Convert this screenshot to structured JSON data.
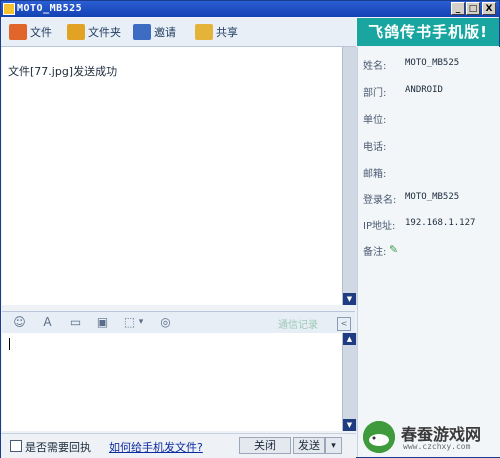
{
  "window": {
    "title": "MOTO_MB525"
  },
  "window_buttons": [
    {
      "icon": "minimize-icon",
      "glyph": "_"
    },
    {
      "icon": "maximize-icon",
      "glyph": "□"
    },
    {
      "icon": "close-icon",
      "glyph": "X"
    }
  ],
  "toolbar": {
    "items": [
      {
        "label": "文件",
        "icon": "file-send-icon",
        "color": "#e0662b"
      },
      {
        "label": "文件夹",
        "icon": "folder-send-icon",
        "color": "#e2a324"
      },
      {
        "label": "邀请",
        "icon": "invite-icon",
        "color": "#3d6cc2"
      },
      {
        "label": "共享",
        "icon": "share-folder-icon",
        "color": "#e5b33a"
      }
    ]
  },
  "banner": {
    "text": "飞鸽传书手机版!"
  },
  "messages": [
    {
      "text": "文件[77.jpg]发送成功"
    }
  ],
  "format_toolbar": {
    "icons": [
      {
        "name": "emoji-icon",
        "glyph": "☺"
      },
      {
        "name": "font-icon",
        "glyph": "A"
      },
      {
        "name": "message-bubble-icon",
        "glyph": "▭"
      },
      {
        "name": "image-icon",
        "glyph": "▣"
      },
      {
        "name": "screenshot-icon",
        "glyph": "⬚"
      },
      {
        "name": "dropdown-arrow-icon",
        "glyph": "▾"
      },
      {
        "name": "shake-icon",
        "glyph": "◎"
      }
    ],
    "history_label": "通信记录"
  },
  "bottom": {
    "receipt_checkbox_label": "是否需要回执",
    "help_link": "如何给手机发文件?",
    "close_button": "关闭",
    "send_button": "发送"
  },
  "contact_info": [
    {
      "label": "姓名:",
      "value": "MOTO_MB525"
    },
    {
      "label": "部门:",
      "value": "ANDROID"
    },
    {
      "label": "单位:",
      "value": ""
    },
    {
      "label": "电话:",
      "value": ""
    },
    {
      "label": "邮箱:",
      "value": ""
    },
    {
      "label": "登录名:",
      "value": "MOTO_MB525"
    },
    {
      "label": "IP地址:",
      "value": "192.168.1.127"
    },
    {
      "label": "备注:",
      "value": ""
    }
  ],
  "watermark": {
    "title": "春蚕游戏网",
    "url": "www.czchxy.com"
  },
  "colors": {
    "title_bar": "#1341b3",
    "banner": "#1aa6a0",
    "link": "#0c2a9e",
    "scrollbar_button": "#1f3c83"
  }
}
